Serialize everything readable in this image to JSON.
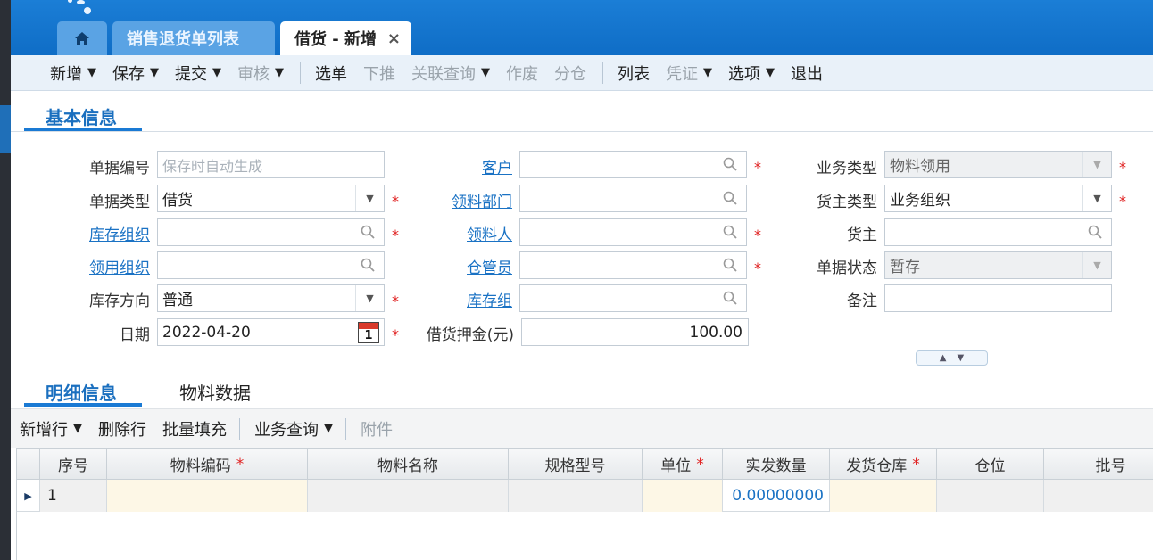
{
  "tabs": {
    "list_label": "销售退货单列表",
    "active_label": "借货 - 新增",
    "close_glyph": "×"
  },
  "toolbar": {
    "items": [
      {
        "label": "新增",
        "caret": true,
        "disabled": false
      },
      {
        "label": "保存",
        "caret": true,
        "disabled": false
      },
      {
        "label": "提交",
        "caret": true,
        "disabled": false
      },
      {
        "label": "审核",
        "caret": true,
        "disabled": true
      },
      {
        "label": "选单",
        "caret": false,
        "disabled": false
      },
      {
        "label": "下推",
        "caret": false,
        "disabled": true
      },
      {
        "label": "关联查询",
        "caret": true,
        "disabled": true
      },
      {
        "label": "作废",
        "caret": false,
        "disabled": true
      },
      {
        "label": "分仓",
        "caret": false,
        "disabled": true
      },
      {
        "label": "列表",
        "caret": false,
        "disabled": false
      },
      {
        "label": "凭证",
        "caret": true,
        "disabled": true
      },
      {
        "label": "选项",
        "caret": true,
        "disabled": false
      },
      {
        "label": "退出",
        "caret": false,
        "disabled": false
      }
    ]
  },
  "basic": {
    "title": "基本信息",
    "doc_no_label": "单据编号",
    "doc_no_placeholder": "保存时自动生成",
    "doc_type_label": "单据类型",
    "doc_type_value": "借货",
    "stock_org_label": "库存组织",
    "use_org_label": "领用组织",
    "stock_dir_label": "库存方向",
    "stock_dir_value": "普通",
    "date_label": "日期",
    "date_value": "2022-04-20",
    "cal_day": "1",
    "customer_label": "客户",
    "dept_label": "领料部门",
    "picker_label": "领料人",
    "keeper_label": "仓管员",
    "stock_group_label": "库存组",
    "deposit_label": "借货押金(元)",
    "deposit_value": "100.00",
    "biz_type_label": "业务类型",
    "biz_type_value": "物料领用",
    "owner_type_label": "货主类型",
    "owner_type_value": "业务组织",
    "owner_label": "货主",
    "status_label": "单据状态",
    "status_value": "暂存",
    "remark_label": "备注",
    "required_mark": "*"
  },
  "detail": {
    "tab_detail": "明细信息",
    "tab_material": "物料数据",
    "toolbar": [
      {
        "label": "新增行",
        "caret": true,
        "disabled": false
      },
      {
        "label": "删除行",
        "caret": false,
        "disabled": false
      },
      {
        "label": "批量填充",
        "caret": false,
        "disabled": false
      },
      {
        "label": "业务查询",
        "caret": true,
        "disabled": false
      },
      {
        "label": "附件",
        "caret": false,
        "disabled": true
      }
    ],
    "columns": [
      "序号",
      "物料编码",
      "物料名称",
      "规格型号",
      "单位",
      "实发数量",
      "发货仓库",
      "仓位",
      "批号"
    ],
    "required_columns": [
      "物料编码",
      "单位",
      "发货仓库"
    ],
    "rows": [
      {
        "seq": "1",
        "qty": "0.00000000"
      }
    ]
  }
}
